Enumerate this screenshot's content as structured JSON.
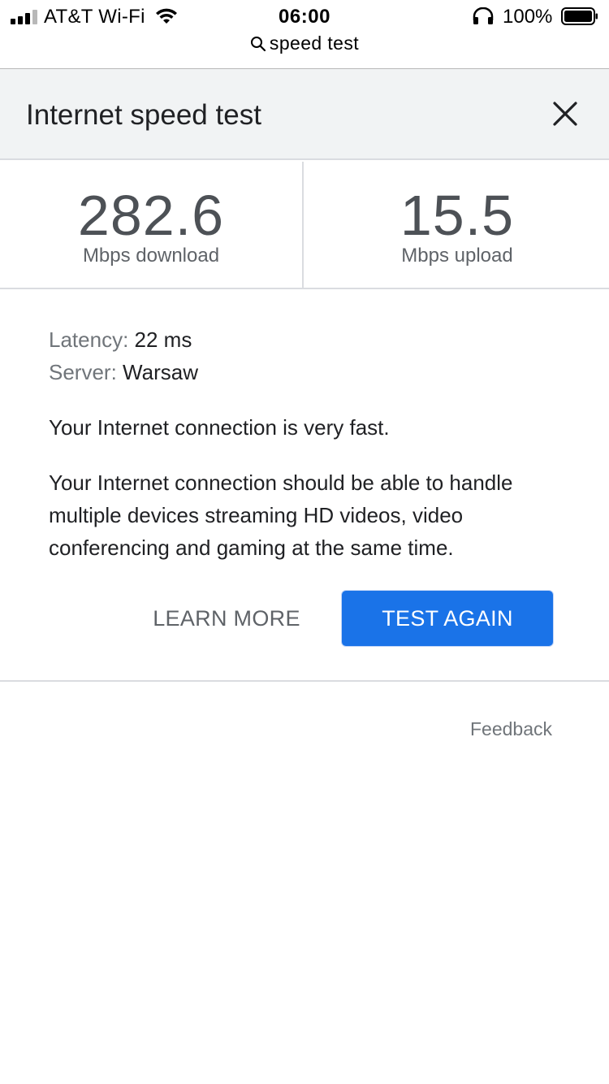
{
  "status_bar": {
    "carrier": "AT&T Wi-Fi",
    "time": "06:00",
    "battery": "100%",
    "icons": [
      "signal-icon",
      "wifi-icon",
      "headphones-icon",
      "battery-icon"
    ]
  },
  "url_bar": {
    "query": "speed test",
    "icon": "search-icon"
  },
  "header": {
    "title": "Internet speed test",
    "close_icon": "close-icon"
  },
  "results": {
    "download": {
      "value": "282.6",
      "unit": "Mbps download"
    },
    "upload": {
      "value": "15.5",
      "unit": "Mbps upload"
    }
  },
  "info": {
    "latency_label": "Latency:",
    "latency_value": "22 ms",
    "server_label": "Server:",
    "server_value": "Warsaw"
  },
  "verdict": "Your Internet connection is very fast.",
  "description": "Your Internet connection should be able to handle multiple devices streaming HD videos, video conferencing and gaming at the same time.",
  "actions": {
    "learn_more": "LEARN MORE",
    "test_again": "TEST AGAIN"
  },
  "feedback": "Feedback",
  "colors": {
    "accent": "#1a73e8",
    "header_bg": "#f1f3f4",
    "divider": "#dadce0"
  }
}
